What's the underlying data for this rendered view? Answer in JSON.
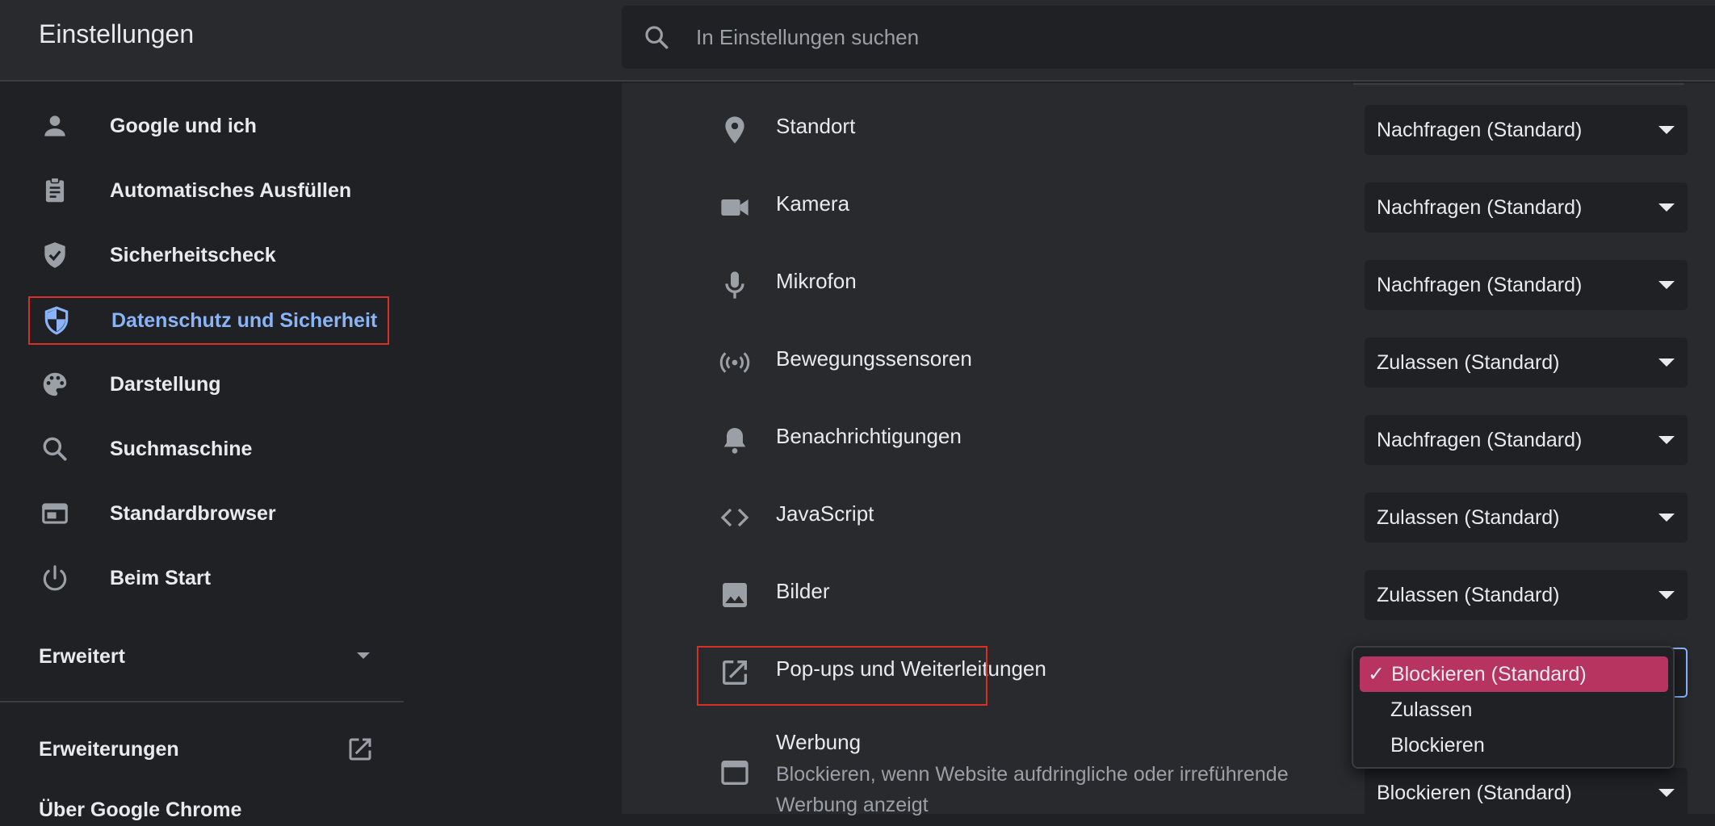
{
  "header": {
    "title": "Einstellungen",
    "search_placeholder": "In Einstellungen suchen"
  },
  "sidebar": {
    "items": [
      {
        "label": "Google und ich",
        "icon": "person-icon"
      },
      {
        "label": "Automatisches Ausfüllen",
        "icon": "clipboard-icon"
      },
      {
        "label": "Sicherheitscheck",
        "icon": "shield-check-icon"
      },
      {
        "label": "Datenschutz und Sicherheit",
        "icon": "shield-half-icon"
      },
      {
        "label": "Darstellung",
        "icon": "palette-icon"
      },
      {
        "label": "Suchmaschine",
        "icon": "search-icon"
      },
      {
        "label": "Standardbrowser",
        "icon": "browser-window-icon"
      },
      {
        "label": "Beim Start",
        "icon": "power-icon"
      }
    ],
    "advanced_label": "Erweitert",
    "extensions_label": "Erweiterungen",
    "about_label": "Über Google Chrome"
  },
  "settings": [
    {
      "label": "Standort",
      "value": "Nachfragen (Standard)",
      "icon": "location-pin-icon"
    },
    {
      "label": "Kamera",
      "value": "Nachfragen (Standard)",
      "icon": "camera-icon"
    },
    {
      "label": "Mikrofon",
      "value": "Nachfragen (Standard)",
      "icon": "microphone-icon"
    },
    {
      "label": "Bewegungssensoren",
      "value": "Zulassen (Standard)",
      "icon": "motion-sensor-icon"
    },
    {
      "label": "Benachrichtigungen",
      "value": "Nachfragen (Standard)",
      "icon": "bell-icon"
    },
    {
      "label": "JavaScript",
      "value": "Zulassen (Standard)",
      "icon": "code-icon"
    },
    {
      "label": "Bilder",
      "value": "Zulassen (Standard)",
      "icon": "image-icon"
    },
    {
      "label": "Pop-ups und Weiterleitungen",
      "value": "Blockieren (Standard)",
      "icon": "open-in-new-icon"
    }
  ],
  "werbung": {
    "label": "Werbung",
    "description": "Blockieren, wenn Website aufdringliche oder irreführende Werbung anzeigt",
    "value": "Blockieren (Standard)"
  },
  "popup_dropdown": {
    "check": "✓",
    "options": [
      "Blockieren (Standard)",
      "Zulassen",
      "Blockieren"
    ]
  },
  "colors": {
    "accent": "#8ab4f8",
    "selected_option": "#b6345f",
    "highlight": "#d93025"
  }
}
